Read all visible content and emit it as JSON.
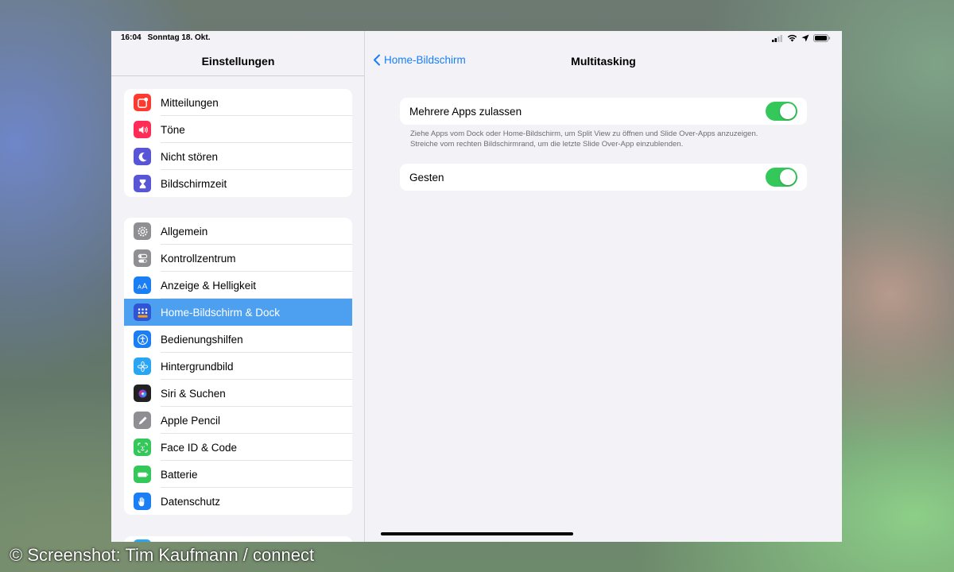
{
  "status": {
    "time": "16:04",
    "date": "Sonntag 18. Okt."
  },
  "sidebar": {
    "title": "Einstellungen",
    "groups": [
      {
        "items": [
          {
            "label": "Mitteilungen",
            "icon": "notifications-icon",
            "color": "#ff3b30"
          },
          {
            "label": "Töne",
            "icon": "speaker-icon",
            "color": "#ff2d55"
          },
          {
            "label": "Nicht stören",
            "icon": "moon-icon",
            "color": "#5856d6"
          },
          {
            "label": "Bildschirmzeit",
            "icon": "hourglass-icon",
            "color": "#5856d6"
          }
        ]
      },
      {
        "items": [
          {
            "label": "Allgemein",
            "icon": "gear-icon",
            "color": "#8e8e93"
          },
          {
            "label": "Kontrollzentrum",
            "icon": "switches-icon",
            "color": "#8e8e93"
          },
          {
            "label": "Anzeige & Helligkeit",
            "icon": "text-size-icon",
            "color": "#1a7ef5"
          },
          {
            "label": "Home-Bildschirm & Dock",
            "icon": "app-grid-icon",
            "color": "#2f55d4",
            "selected": true
          },
          {
            "label": "Bedienungshilfen",
            "icon": "accessibility-icon",
            "color": "#1a7ef5"
          },
          {
            "label": "Hintergrundbild",
            "icon": "flower-icon",
            "color": "#2aa5f3"
          },
          {
            "label": "Siri & Suchen",
            "icon": "siri-icon",
            "color": "#222222"
          },
          {
            "label": "Apple Pencil",
            "icon": "pencil-icon",
            "color": "#8e8e93"
          },
          {
            "label": "Face ID & Code",
            "icon": "face-id-icon",
            "color": "#34c759"
          },
          {
            "label": "Batterie",
            "icon": "battery-icon",
            "color": "#34c759"
          },
          {
            "label": "Datenschutz",
            "icon": "hand-icon",
            "color": "#1a7ef5"
          }
        ]
      }
    ]
  },
  "detail": {
    "back_label": "Home-Bildschirm",
    "title": "Multitasking",
    "settings": [
      {
        "label": "Mehrere Apps zulassen",
        "enabled": true
      },
      {
        "label": "Gesten",
        "enabled": true
      }
    ],
    "footnote_line1": "Ziehe Apps vom Dock oder Home-Bildschirm, um Split View zu öffnen und Slide Over-Apps anzuzeigen.",
    "footnote_line2": "Streiche vom rechten Bildschirmrand, um die letzte Slide Over-App einzublenden."
  },
  "colors": {
    "accent": "#1a7ef5",
    "toggle_on": "#34c759",
    "selection": "#4d9ff0"
  },
  "watermark": "© Screenshot: Tim Kaufmann / connect"
}
